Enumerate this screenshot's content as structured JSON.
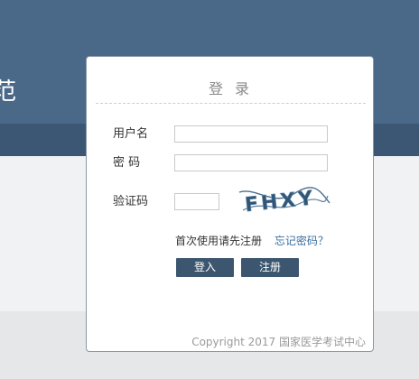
{
  "background": {
    "header_color": "#4a6887",
    "band_color": "#3c5773",
    "partial_title_glyph": "范"
  },
  "login": {
    "title": "登 录",
    "username_label": "用户名",
    "password_label": "密 码",
    "captcha_label": "验证码",
    "username_value": "",
    "password_value": "",
    "captcha_value": "",
    "captcha_text": "FHXY",
    "first_use_text": "首次使用请先注册",
    "forgot_password_link": "忘记密码？",
    "login_button": "登入",
    "register_button": "注册",
    "accent_color": "#3c5670",
    "link_color": "#3b6fa0"
  },
  "footer": {
    "copyright": "Copyright 2017 国家医学考试中心"
  }
}
